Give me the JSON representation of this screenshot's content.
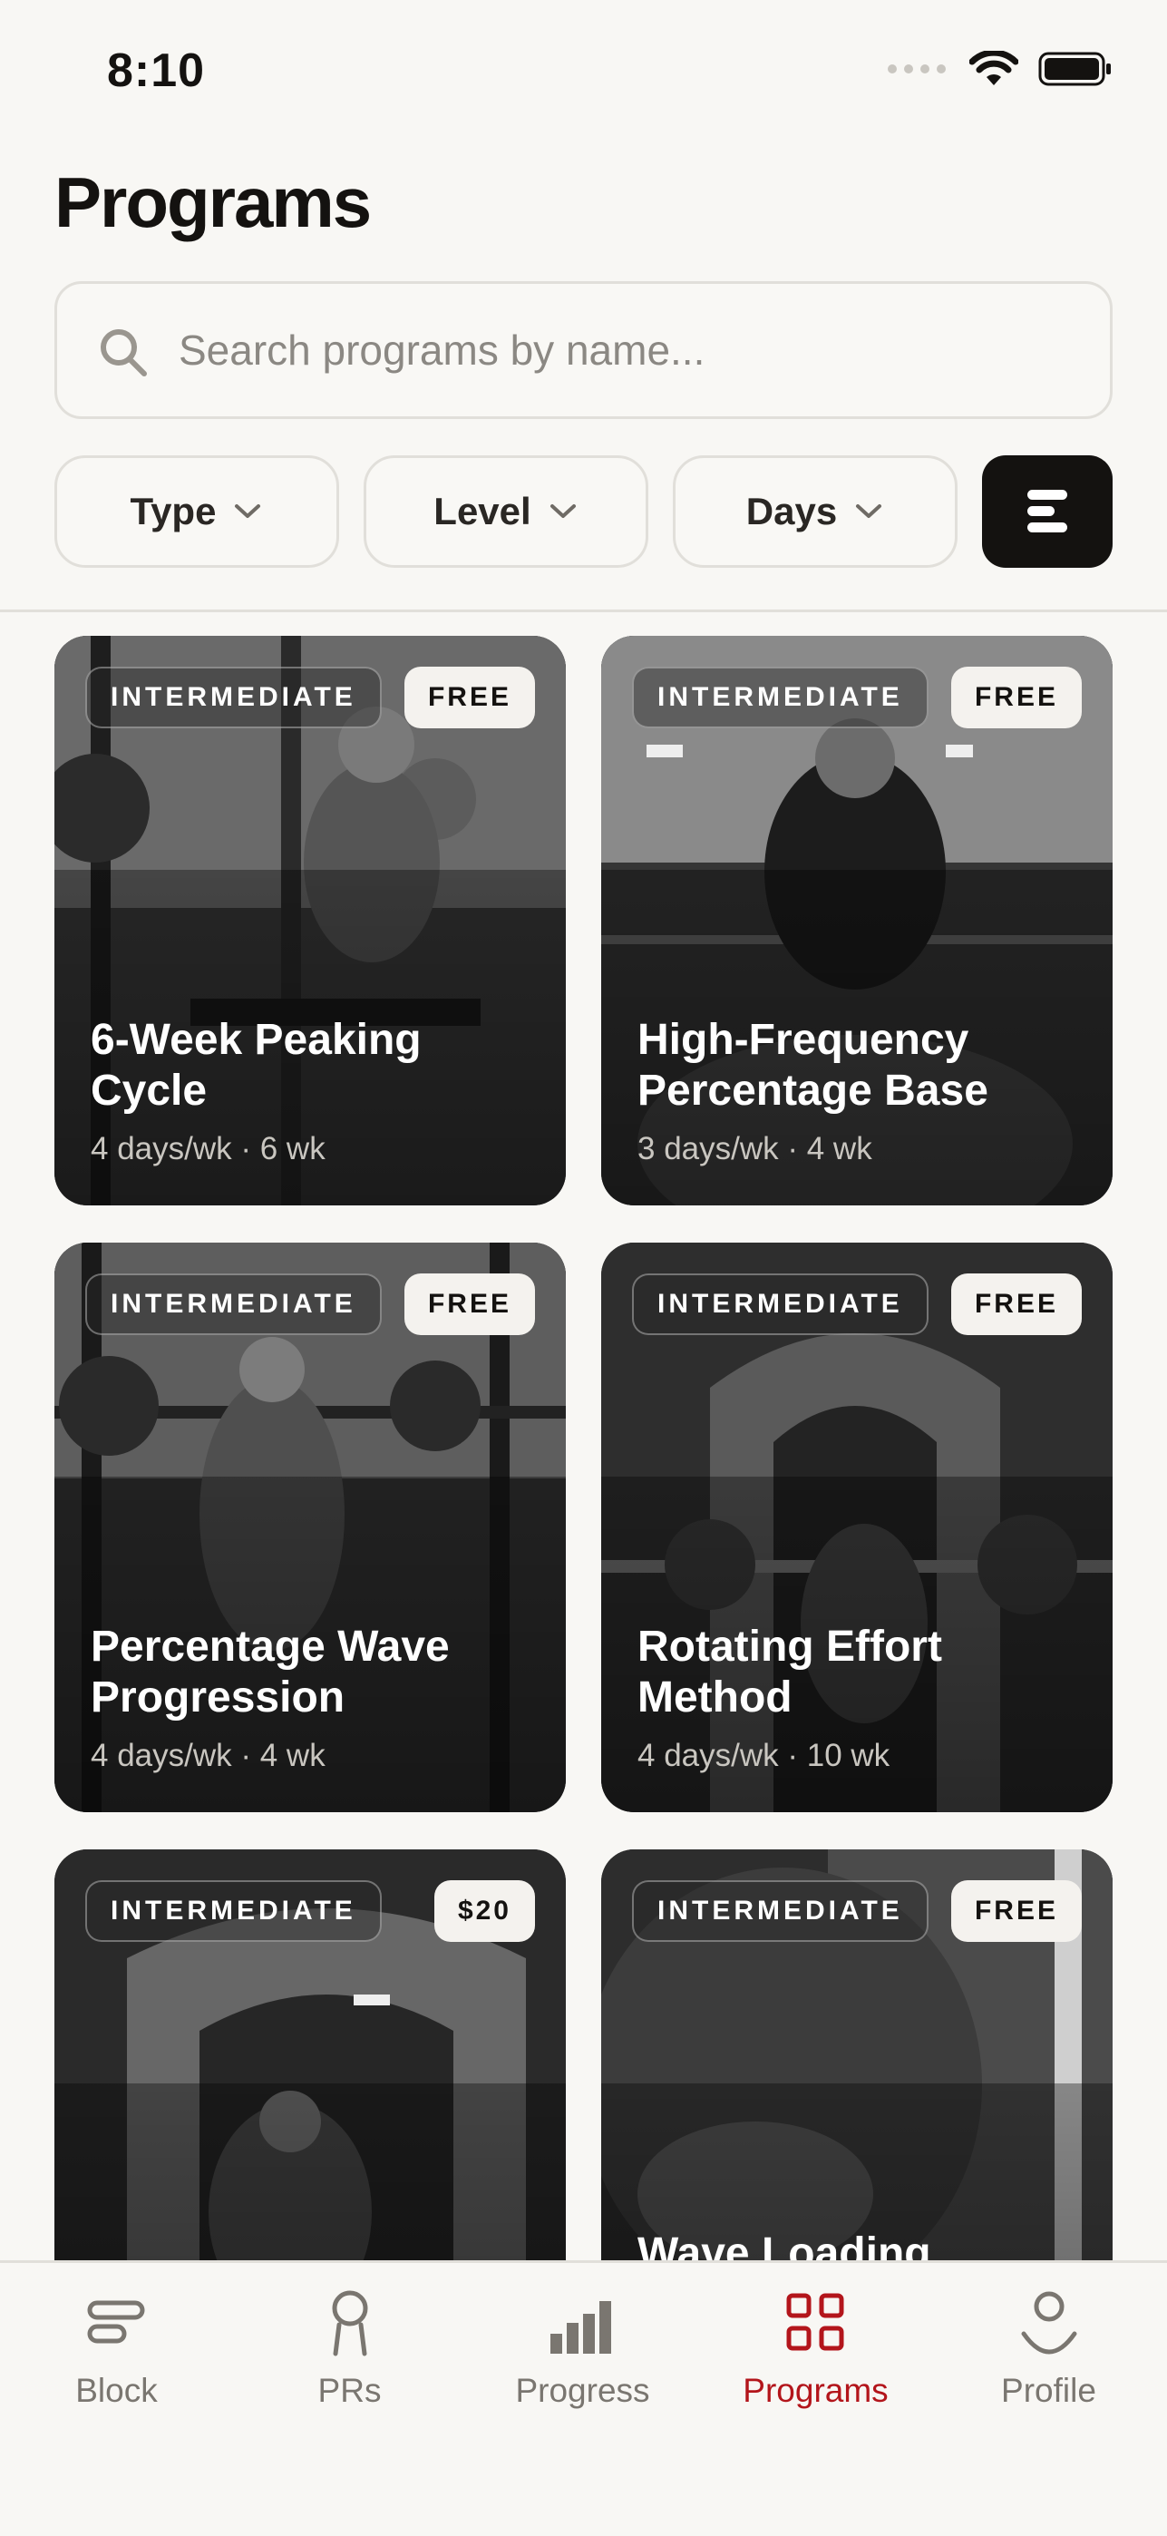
{
  "status_bar": {
    "time": "8:10"
  },
  "header": {
    "title": "Programs"
  },
  "search": {
    "placeholder": "Search programs by name..."
  },
  "filters": [
    {
      "label": "Type"
    },
    {
      "label": "Level"
    },
    {
      "label": "Days"
    }
  ],
  "programs": [
    {
      "level": "INTERMEDIATE",
      "price": "FREE",
      "title": "6-Week Peaking Cycle",
      "meta": "4 days/wk · 6 wk"
    },
    {
      "level": "INTERMEDIATE",
      "price": "FREE",
      "title": "High-Frequency Percentage Base",
      "meta": "3 days/wk · 4 wk"
    },
    {
      "level": "INTERMEDIATE",
      "price": "FREE",
      "title": "Percentage Wave Progression",
      "meta": "4 days/wk · 4 wk"
    },
    {
      "level": "INTERMEDIATE",
      "price": "FREE",
      "title": "Rotating Effort Method",
      "meta": "4 days/wk · 10 wk"
    },
    {
      "level": "INTERMEDIATE",
      "price": "$20",
      "title": "",
      "meta": ""
    },
    {
      "level": "INTERMEDIATE",
      "price": "FREE",
      "title": "Wave Loading",
      "meta": ""
    }
  ],
  "tabs": [
    {
      "label": "Block",
      "icon": "block-icon"
    },
    {
      "label": "PRs",
      "icon": "pr-icon"
    },
    {
      "label": "Progress",
      "icon": "bar-chart-icon"
    },
    {
      "label": "Programs",
      "icon": "grid-icon",
      "active": true
    },
    {
      "label": "Profile",
      "icon": "profile-icon"
    }
  ],
  "colors": {
    "accent": "#b3151b",
    "ink": "#141210",
    "background": "#f8f7f4"
  }
}
